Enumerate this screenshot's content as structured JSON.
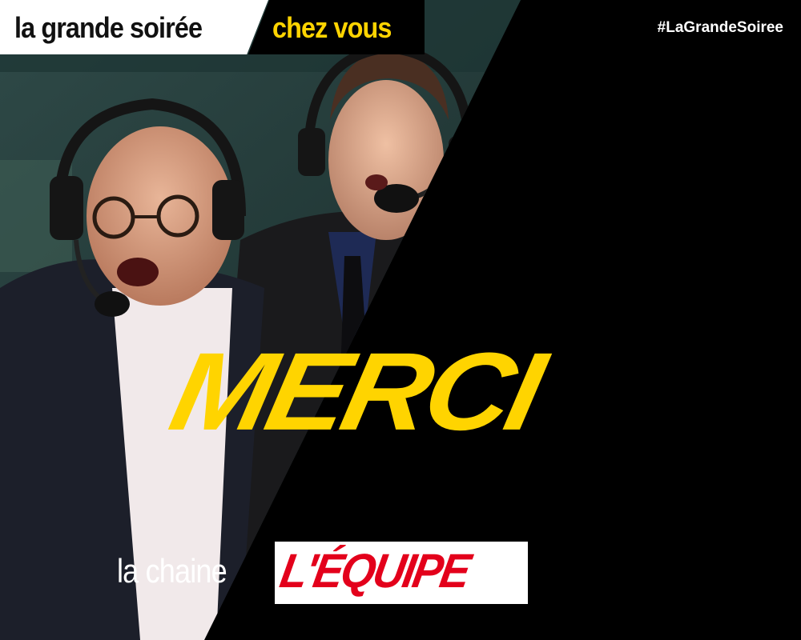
{
  "banner": {
    "title_part1": "la grande soirée",
    "title_part2": "chez vous",
    "hashtag": "#LaGrandeSoiree"
  },
  "headline": "MERCI",
  "footer": {
    "prefix": "la chaine",
    "logo_text": "L'ÉQUIPE"
  },
  "colors": {
    "accent": "#ffd400",
    "brand_red": "#e3001b",
    "background": "#000000"
  }
}
